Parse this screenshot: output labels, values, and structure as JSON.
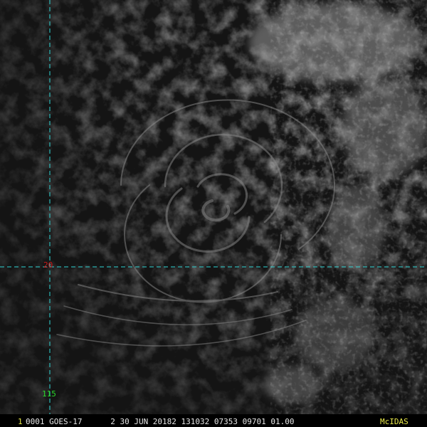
{
  "image": {
    "satellite": "GOES-17",
    "subject": "tropical cyclone cloud swirl",
    "colors": {
      "background": "#000000",
      "grid_line": "#2fd6d6",
      "latitude_label": "#d01818",
      "longitude_label": "#2ad82a",
      "footer_text": "#e6e6e6",
      "frame_number": "#e8e84a",
      "brand": "#e8e84a"
    }
  },
  "grid": {
    "latitude_label": "20",
    "longitude_label": "115"
  },
  "footer": {
    "frame_number": "1",
    "info_text": "0001 GOES-17      2 30 JUN 20182 131032 07353 09701 01.00",
    "brand": "McIDAS"
  }
}
